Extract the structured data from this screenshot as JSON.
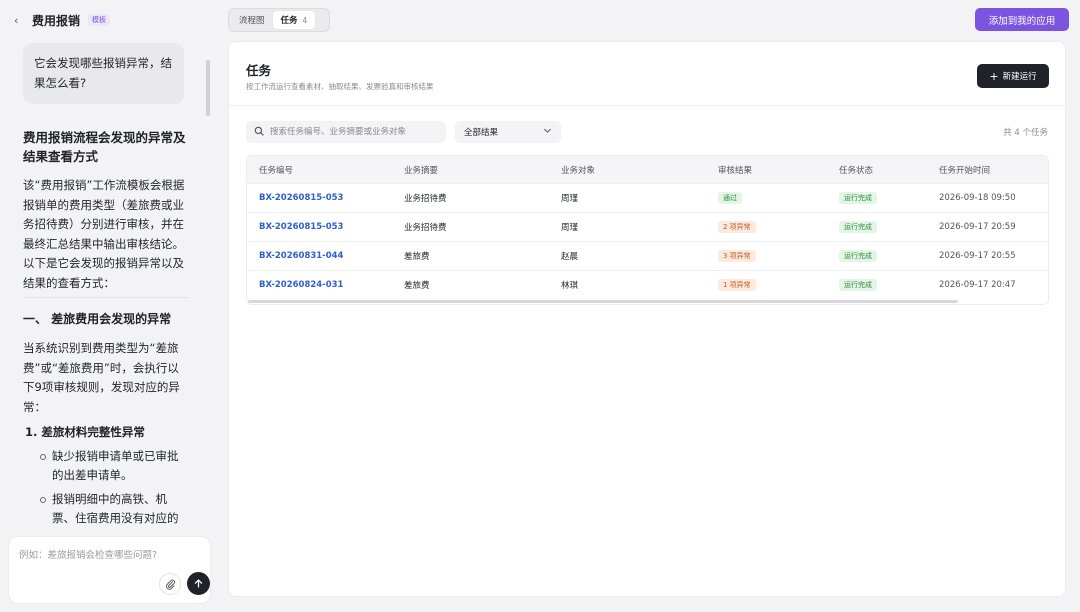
{
  "sidebar": {
    "back_label": "‹",
    "title": "费用报销",
    "badge": "模板",
    "user_question": "它会发现哪些报销异常，结果怎么看?",
    "answer": {
      "heading": "费用报销流程会发现的异常及结果查看方式",
      "intro": "该“费用报销”工作流模板会根据报销单的费用类型（差旅费或业务招待费）分别进行审核，并在最终汇总结果中输出审核结论。以下是它会发现的报销异常以及结果的查看方式：",
      "section1_title": "一、 差旅费用会发现的异常",
      "section1_text": "当系统识别到费用类型为“差旅费”或“差旅费用”时，会执行以下9项审核规则，发现对应的异常：",
      "item1_title": "1. 差旅材料完整性异常",
      "item1_bullets": [
        "缺少报销申请单或已审批的出差申请单。",
        "报销明细中的高铁、机票、住宿费用没有对应的发票。"
      ]
    },
    "input_placeholder": "例如：差旅报销会检查哪些问题?",
    "attach_icon": "paperclip-icon",
    "send_icon": "arrow-up-icon"
  },
  "topbar": {
    "tabs": [
      {
        "label": "流程图"
      },
      {
        "label": "任务",
        "count": "4"
      }
    ],
    "add_app_label": "添加到我的应用"
  },
  "main": {
    "title": "任务",
    "subtitle": "按工作流运行查看素材、抽取结果、发票验真和审核结果",
    "new_run_label": "新建运行",
    "search_placeholder": "搜索任务编号、业务摘要或业务对象",
    "filter_value": "全部结果",
    "total_label": "共 4 个任务",
    "columns": [
      "任务编号",
      "业务摘要",
      "业务对象",
      "审核结果",
      "任务状态",
      "任务开始时间"
    ],
    "rows": [
      {
        "id": "BX-20260815-053",
        "summary": "业务招待费",
        "target": "周瑾",
        "result": "通过",
        "result_type": "pass",
        "status": "运行完成",
        "start": "2026-09-18 09:50"
      },
      {
        "id": "BX-20260815-053",
        "summary": "业务招待费",
        "target": "周瑾",
        "result": "2 项异常",
        "result_type": "warn",
        "status": "运行完成",
        "start": "2026-09-17 20:59"
      },
      {
        "id": "BX-20260831-044",
        "summary": "差旅费",
        "target": "赵晨",
        "result": "3 项异常",
        "result_type": "warn",
        "status": "运行完成",
        "start": "2026-09-17 20:55"
      },
      {
        "id": "BX-20260824-031",
        "summary": "差旅费",
        "target": "林琪",
        "result": "1 项异常",
        "result_type": "warn",
        "status": "运行完成",
        "start": "2026-09-17 20:47"
      }
    ]
  },
  "colors": {
    "accent": "#7b55e0",
    "link": "#2f5fd0",
    "dark_button": "#1f2329"
  }
}
